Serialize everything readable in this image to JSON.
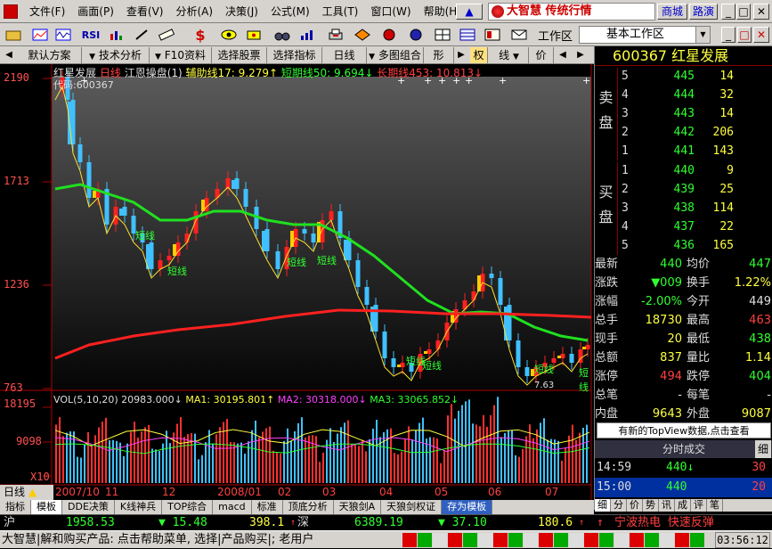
{
  "menubar": {
    "items": [
      "文件(F)",
      "画面(P)",
      "查看(V)",
      "分析(A)",
      "决策(J)",
      "公式(M)",
      "工具(T)",
      "窗口(W)",
      "帮助(H)"
    ],
    "brand": "大智慧 传统行情",
    "mall": "商城",
    "roadshow": "路演"
  },
  "toolbar": {
    "rsi_label": "RSI",
    "dollar_label": "$",
    "workspace_label": "工作区",
    "workspace_value": "基本工作区"
  },
  "tabstrip": {
    "tabs": [
      "默认方案",
      "技术分析",
      "F10资料",
      "选择股票",
      "选择指标",
      "日线",
      "多图组合",
      "形",
      "权",
      "线",
      "价"
    ]
  },
  "chart": {
    "title_stock": "红星发展",
    "title_period": "日线",
    "indicator_name": "江恩操盘(1)",
    "aux_line": "辅助线17: 9.279↑",
    "short_line": "短期线50: 9.694↓",
    "long_line": "长期线453: 10.813↓",
    "code_label": "代码:600367",
    "y_labels": [
      "2190",
      "1713",
      "1236",
      "763"
    ],
    "short_line_tag": "短线",
    "price_annotation": "7.63",
    "vol_header": "VOL(5,10,20) 20983.000↓",
    "vol_ma1": "MA1: 30195.801↑",
    "vol_ma2": "MA2: 30318.000↓",
    "vol_ma3": "MA3: 33065.852↓",
    "vol_y_labels": [
      "18195",
      "9098",
      "X10"
    ],
    "x_labels": [
      "2007/10",
      "11",
      "12",
      "2008/01",
      "02",
      "03",
      "04",
      "05",
      "06",
      "07"
    ],
    "period_tab": "日线"
  },
  "func_tabs": [
    "指标",
    "模板",
    "DDE决策",
    "K线神兵",
    "TOP综合",
    "macd",
    "标准",
    "顶底分析",
    "天狼剑A",
    "天狼剑权证",
    "存为模板"
  ],
  "right_panel": {
    "code": "600367",
    "name": "红星发展",
    "sell_label": "卖盘",
    "buy_label": "买盘",
    "sell": [
      {
        "level": "5",
        "price": "445",
        "vol": "14"
      },
      {
        "level": "4",
        "price": "444",
        "vol": "32"
      },
      {
        "level": "3",
        "price": "443",
        "vol": "14"
      },
      {
        "level": "2",
        "price": "442",
        "vol": "206"
      },
      {
        "level": "1",
        "price": "441",
        "vol": "143"
      }
    ],
    "buy": [
      {
        "level": "1",
        "price": "440",
        "vol": "9"
      },
      {
        "level": "2",
        "price": "439",
        "vol": "25"
      },
      {
        "level": "3",
        "price": "438",
        "vol": "114"
      },
      {
        "level": "4",
        "price": "437",
        "vol": "22"
      },
      {
        "level": "5",
        "price": "436",
        "vol": "165"
      }
    ],
    "quotes": [
      {
        "l1": "最新",
        "v1": "440",
        "c1": "green",
        "l2": "均价",
        "v2": "447",
        "c2": "green"
      },
      {
        "l1": "涨跌",
        "v1": "▼009",
        "c1": "green",
        "l2": "换手",
        "v2": "1.22%",
        "c2": "yellow"
      },
      {
        "l1": "涨幅",
        "v1": "-2.00%",
        "c1": "green",
        "l2": "今开",
        "v2": "449",
        "c2": "white"
      },
      {
        "l1": "总手",
        "v1": "18730",
        "c1": "yellow",
        "l2": "最高",
        "v2": "463",
        "c2": "red"
      },
      {
        "l1": "现手",
        "v1": "20",
        "c1": "yellow",
        "l2": "最低",
        "v2": "438",
        "c2": "green"
      },
      {
        "l1": "总额",
        "v1": "837",
        "c1": "yellow",
        "l2": "量比",
        "v2": "1.14",
        "c2": "yellow"
      },
      {
        "l1": "涨停",
        "v1": "494",
        "c1": "red",
        "l2": "跌停",
        "v2": "404",
        "c2": "green"
      },
      {
        "l1": "总笔",
        "v1": "-",
        "c1": "white",
        "l2": "每笔",
        "v2": "-",
        "c2": "white"
      },
      {
        "l1": "内盘",
        "v1": "9643",
        "c1": "yellow",
        "l2": "外盘",
        "v2": "9087",
        "c2": "yellow"
      }
    ],
    "topview": "有新的TopView数据,点击查看",
    "tick_header": "分时成交",
    "tick_mini": "细",
    "ticks": [
      {
        "time": "14:59",
        "price": "440↓",
        "vol": "30"
      },
      {
        "time": "15:00",
        "price": "440",
        "vol": "20"
      }
    ],
    "bottom_tabs": [
      "细",
      "分",
      "价",
      "势",
      "讯",
      "成",
      "评",
      "笔"
    ]
  },
  "indexbar": {
    "sh_label": "沪",
    "sh_value": "1958.53",
    "sh_change": "▼ 15.48",
    "sh_amount": "398.1",
    "sz_label": "深",
    "sz_value": "6389.19",
    "sz_change": "▼ 37.10",
    "sz_amount": "180.6",
    "ticker": "宁波热电 快速反弹"
  },
  "statusbar": {
    "message": "大智慧|解和购买产品: 点击帮助菜单, 选择|产品购买|; 老用户",
    "clock": "03:56:12"
  }
}
